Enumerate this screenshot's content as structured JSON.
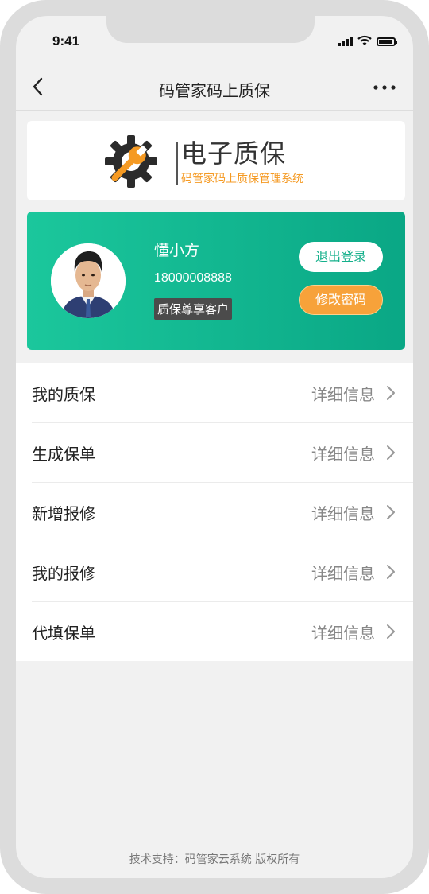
{
  "status_bar": {
    "time": "9:41"
  },
  "navbar": {
    "title": "码管家码上质保"
  },
  "brand": {
    "title": "电子质保",
    "subtitle": "码管家码上质保管理系统",
    "accent_color": "#f59a23"
  },
  "profile": {
    "name": "懂小方",
    "phone": "18000008888",
    "badge": "质保尊享客户",
    "logout_label": "退出登录",
    "change_password_label": "修改密码",
    "card_colors": [
      "#1bc79c",
      "#0aa785"
    ]
  },
  "menu": {
    "items": [
      {
        "label": "我的质保",
        "detail": "详细信息"
      },
      {
        "label": "生成保单",
        "detail": "详细信息"
      },
      {
        "label": "新增报修",
        "detail": "详细信息"
      },
      {
        "label": "我的报修",
        "detail": "详细信息"
      },
      {
        "label": "代填保单",
        "detail": "详细信息"
      }
    ]
  },
  "footer": {
    "text": "技术支持：码管家云系统 版权所有"
  },
  "icons": [
    "back-arrow-icon",
    "more-dots-icon",
    "gear-wrench-icon",
    "chevron-right-icon",
    "signal-icon",
    "wifi-icon",
    "battery-icon"
  ]
}
